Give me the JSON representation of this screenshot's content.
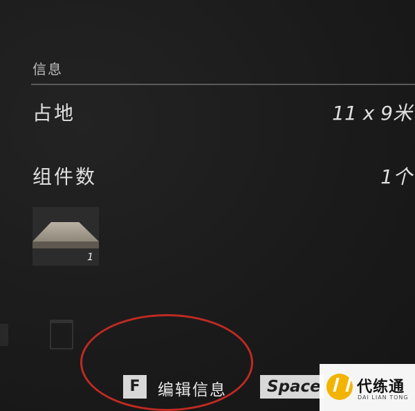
{
  "info": {
    "section_title": "信息",
    "rows": [
      {
        "label": "占地",
        "value": "11 x 9米"
      },
      {
        "label": "组件数",
        "value": "1个"
      }
    ]
  },
  "component": {
    "icon": "wood-plank-icon",
    "count": "1"
  },
  "actions": {
    "edit_key": "F",
    "edit_label": "编辑信息",
    "space_key": "Space"
  },
  "watermark": {
    "text": "代练通",
    "subtext": "DAI LIAN TONG"
  },
  "colors": {
    "highlight_circle": "#c02a22",
    "logo_accent": "#f2b400"
  }
}
